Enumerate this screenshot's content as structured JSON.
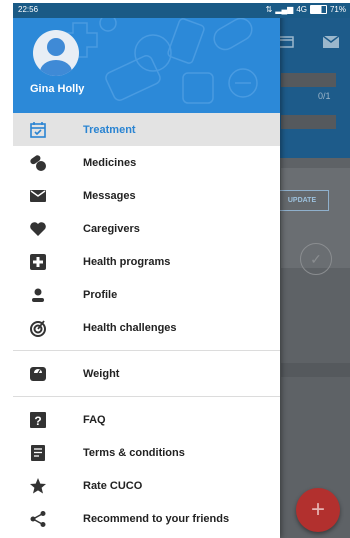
{
  "status_bar": {
    "time": "22:56",
    "network": "4G",
    "battery": "71%"
  },
  "background": {
    "progress": "0/1",
    "update_button": "UPDATE",
    "fab_symbol": "+"
  },
  "drawer": {
    "user_name": "Gina Holly",
    "items": [
      {
        "label": "Treatment",
        "icon": "calendar-check-icon",
        "active": true
      },
      {
        "label": "Medicines",
        "icon": "pills-icon"
      },
      {
        "label": "Messages",
        "icon": "envelope-icon"
      },
      {
        "label": "Caregivers",
        "icon": "heart-icon"
      },
      {
        "label": "Health programs",
        "icon": "plus-box-icon"
      },
      {
        "label": "Profile",
        "icon": "person-icon"
      },
      {
        "label": "Health challenges",
        "icon": "target-icon"
      },
      {
        "label": "Weight",
        "icon": "scale-icon"
      },
      {
        "label": "FAQ",
        "icon": "question-box-icon"
      },
      {
        "label": "Terms & conditions",
        "icon": "document-icon"
      },
      {
        "label": "Rate CUCO",
        "icon": "star-icon"
      },
      {
        "label": "Recommend to your friends",
        "icon": "share-icon"
      }
    ]
  },
  "colors": {
    "accent": "#2a84d2",
    "header": "#2c89d8",
    "fab": "#b2302e",
    "icon": "#333333"
  }
}
